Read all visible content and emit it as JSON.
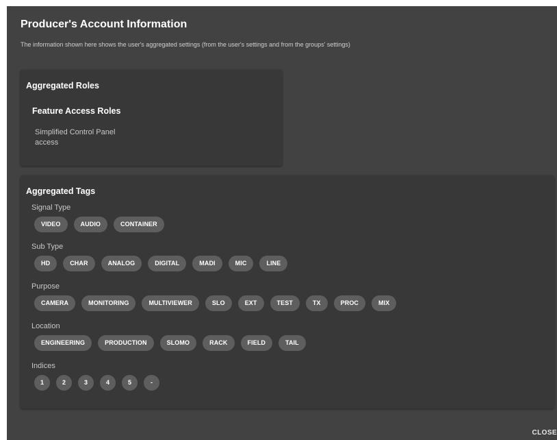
{
  "dialog": {
    "title": "Producer's Account Information",
    "subtitle": "The information shown here shows the user's aggregated settings (from the user's settings and from the groups' settings)",
    "close_label": "CLOSE"
  },
  "roles": {
    "title": "Aggregated Roles",
    "section_title": "Feature Access Roles",
    "items": [
      "Simplified Control Panel access"
    ]
  },
  "tags": {
    "title": "Aggregated Tags",
    "groups": [
      {
        "label": "Signal Type",
        "chips": [
          "VIDEO",
          "AUDIO",
          "CONTAINER"
        ]
      },
      {
        "label": "Sub Type",
        "chips": [
          "HD",
          "CHAR",
          "ANALOG",
          "DIGITAL",
          "MADI",
          "MIC",
          "LINE"
        ]
      },
      {
        "label": "Purpose",
        "chips": [
          "CAMERA",
          "MONITORING",
          "MULTIVIEWER",
          "SLO",
          "EXT",
          "TEST",
          "TX",
          "PROC",
          "MIX"
        ]
      },
      {
        "label": "Location",
        "chips": [
          "ENGINEERING",
          "PRODUCTION",
          "SLOMO",
          "RACK",
          "FIELD",
          "TAIL"
        ]
      },
      {
        "label": "Indices",
        "chips": [
          "1",
          "2",
          "3",
          "4",
          "5",
          "-"
        ]
      }
    ]
  },
  "colors": {
    "dialog_bg": "#424242",
    "card_bg": "#383838",
    "chip_bg": "#5e5e5e",
    "text_primary": "#ffffff",
    "text_secondary": "#c8c8c8"
  }
}
